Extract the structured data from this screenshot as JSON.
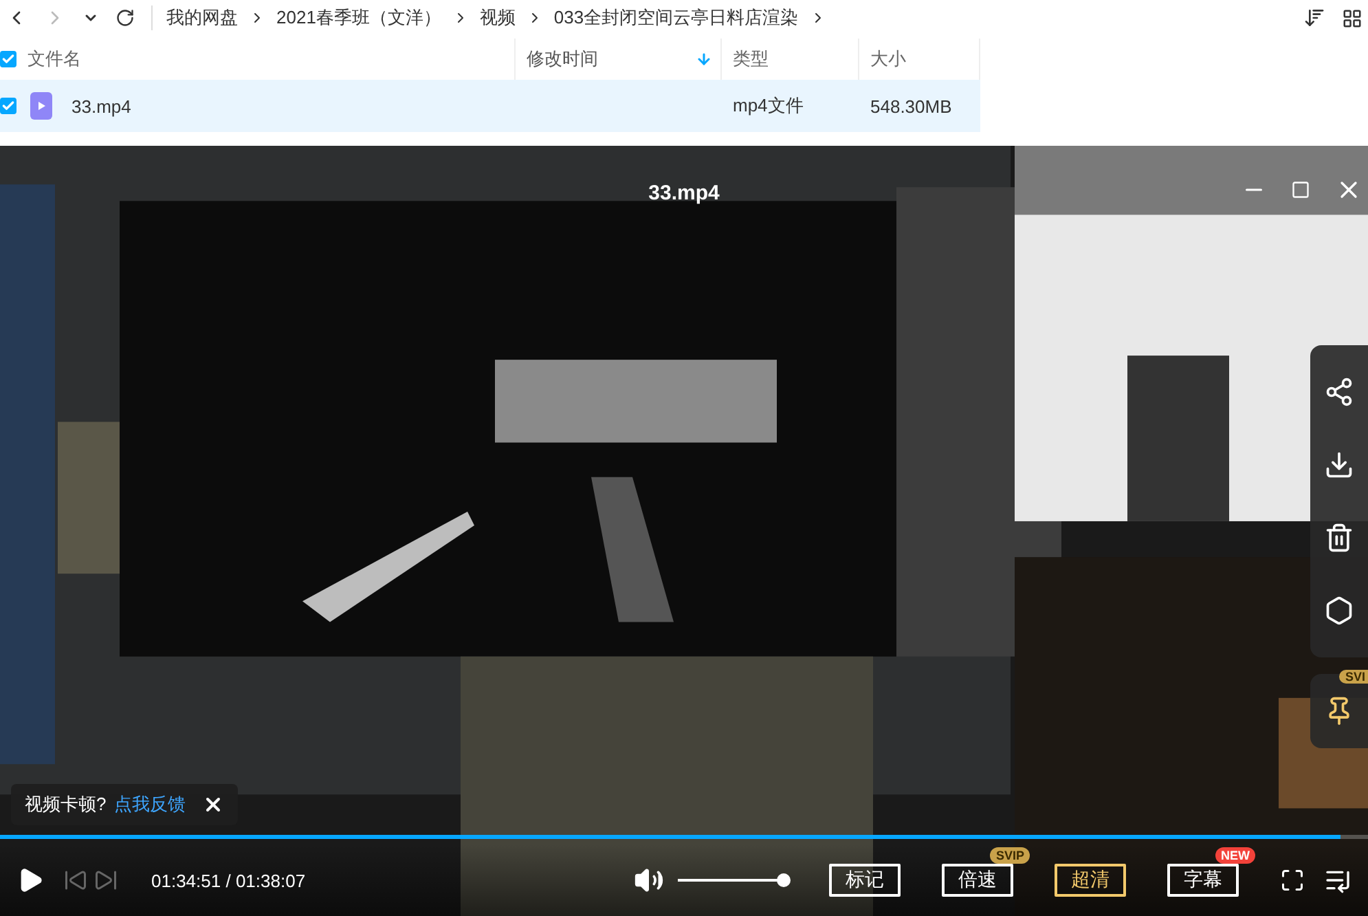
{
  "nav": {
    "breadcrumb": [
      "我的网盘",
      "2021春季班（文洋）",
      "视频",
      "033全封闭空间云亭日料店渲染"
    ]
  },
  "table": {
    "all_checked": true,
    "columns": [
      {
        "label": "文件名",
        "sorted": false
      },
      {
        "label": "修改时间",
        "sorted": true
      },
      {
        "label": "类型",
        "sorted": false
      },
      {
        "label": "大小",
        "sorted": false
      }
    ],
    "rows": [
      {
        "name": "33.mp4",
        "type": "mp4文件",
        "size": "548.30MB",
        "checked": true,
        "selected": true
      }
    ]
  },
  "player": {
    "title": "33.mp4",
    "progress": {
      "level": 0.98
    },
    "time": "01:34:51 / 01:38:07",
    "volume": {
      "level": 0.96
    },
    "buttons": [
      {
        "label": "标记",
        "highlighted": false
      },
      {
        "label": "倍速",
        "badge": "SVIP",
        "highlighted": false
      },
      {
        "label": "超清",
        "highlighted": true
      },
      {
        "label": "字幕",
        "badge": "NEW",
        "highlighted": false
      }
    ],
    "side_badge": "SVI",
    "toast": {
      "text": "视频卡顿?",
      "link": "点我反馈"
    }
  }
}
